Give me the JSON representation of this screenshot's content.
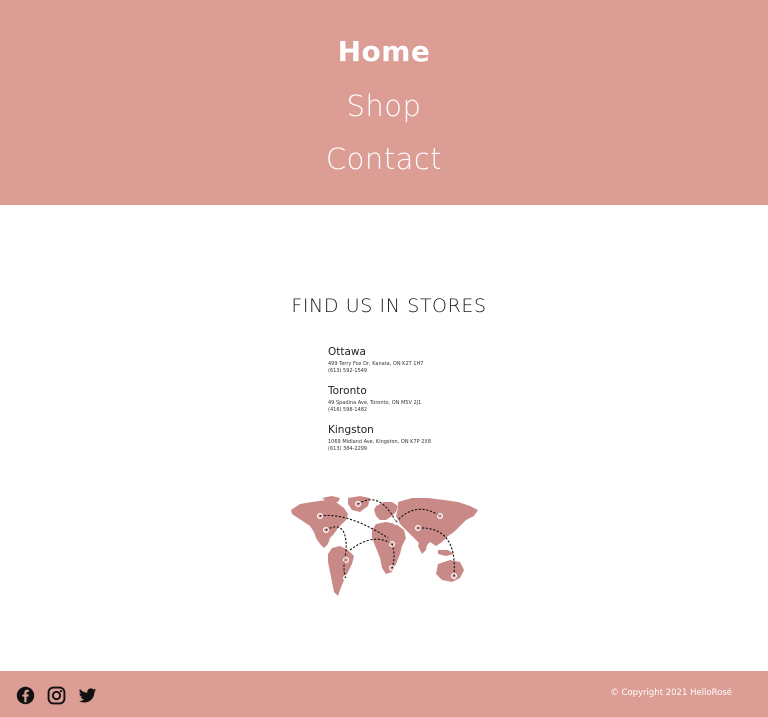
{
  "nav": {
    "home": "Home",
    "shop": "Shop",
    "contact": "Contact"
  },
  "section": {
    "title": "FIND US IN STORES"
  },
  "stores": [
    {
      "city": "Ottawa",
      "address": "499 Terry Fox Dr, Kanata, ON K2T 1H7",
      "phone": "(613) 592-1549"
    },
    {
      "city": "Toronto",
      "address": "49 Spadina Ave, Toronto, ON M5V 2J1",
      "phone": "(416) 598-1482"
    },
    {
      "city": "Kingston",
      "address": "1069 Midland Ave, Kingston, ON K7P 2X8",
      "phone": "(613) 384-2299"
    }
  ],
  "footer": {
    "social": [
      "facebook-icon",
      "instagram-icon",
      "twitter-icon"
    ],
    "copyright": "© Copyright 2021 HelloRosé"
  },
  "colors": {
    "brand": "#dc9d94",
    "map": "#c98a87",
    "background": "#ffffff"
  }
}
